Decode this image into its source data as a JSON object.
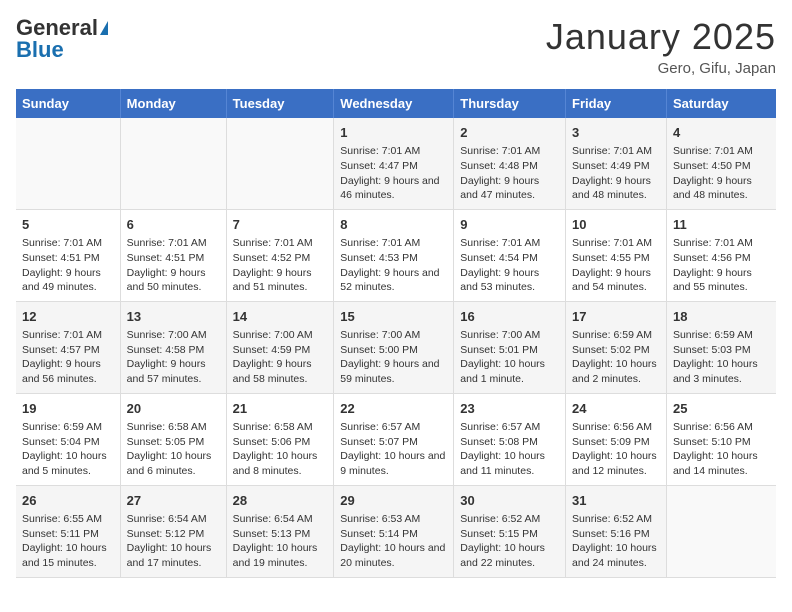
{
  "header": {
    "logo_general": "General",
    "logo_blue": "Blue",
    "month": "January 2025",
    "location": "Gero, Gifu, Japan"
  },
  "weekdays": [
    "Sunday",
    "Monday",
    "Tuesday",
    "Wednesday",
    "Thursday",
    "Friday",
    "Saturday"
  ],
  "weeks": [
    [
      {
        "day": "",
        "info": ""
      },
      {
        "day": "",
        "info": ""
      },
      {
        "day": "",
        "info": ""
      },
      {
        "day": "1",
        "info": "Sunrise: 7:01 AM\nSunset: 4:47 PM\nDaylight: 9 hours and 46 minutes."
      },
      {
        "day": "2",
        "info": "Sunrise: 7:01 AM\nSunset: 4:48 PM\nDaylight: 9 hours and 47 minutes."
      },
      {
        "day": "3",
        "info": "Sunrise: 7:01 AM\nSunset: 4:49 PM\nDaylight: 9 hours and 48 minutes."
      },
      {
        "day": "4",
        "info": "Sunrise: 7:01 AM\nSunset: 4:50 PM\nDaylight: 9 hours and 48 minutes."
      }
    ],
    [
      {
        "day": "5",
        "info": "Sunrise: 7:01 AM\nSunset: 4:51 PM\nDaylight: 9 hours and 49 minutes."
      },
      {
        "day": "6",
        "info": "Sunrise: 7:01 AM\nSunset: 4:51 PM\nDaylight: 9 hours and 50 minutes."
      },
      {
        "day": "7",
        "info": "Sunrise: 7:01 AM\nSunset: 4:52 PM\nDaylight: 9 hours and 51 minutes."
      },
      {
        "day": "8",
        "info": "Sunrise: 7:01 AM\nSunset: 4:53 PM\nDaylight: 9 hours and 52 minutes."
      },
      {
        "day": "9",
        "info": "Sunrise: 7:01 AM\nSunset: 4:54 PM\nDaylight: 9 hours and 53 minutes."
      },
      {
        "day": "10",
        "info": "Sunrise: 7:01 AM\nSunset: 4:55 PM\nDaylight: 9 hours and 54 minutes."
      },
      {
        "day": "11",
        "info": "Sunrise: 7:01 AM\nSunset: 4:56 PM\nDaylight: 9 hours and 55 minutes."
      }
    ],
    [
      {
        "day": "12",
        "info": "Sunrise: 7:01 AM\nSunset: 4:57 PM\nDaylight: 9 hours and 56 minutes."
      },
      {
        "day": "13",
        "info": "Sunrise: 7:00 AM\nSunset: 4:58 PM\nDaylight: 9 hours and 57 minutes."
      },
      {
        "day": "14",
        "info": "Sunrise: 7:00 AM\nSunset: 4:59 PM\nDaylight: 9 hours and 58 minutes."
      },
      {
        "day": "15",
        "info": "Sunrise: 7:00 AM\nSunset: 5:00 PM\nDaylight: 9 hours and 59 minutes."
      },
      {
        "day": "16",
        "info": "Sunrise: 7:00 AM\nSunset: 5:01 PM\nDaylight: 10 hours and 1 minute."
      },
      {
        "day": "17",
        "info": "Sunrise: 6:59 AM\nSunset: 5:02 PM\nDaylight: 10 hours and 2 minutes."
      },
      {
        "day": "18",
        "info": "Sunrise: 6:59 AM\nSunset: 5:03 PM\nDaylight: 10 hours and 3 minutes."
      }
    ],
    [
      {
        "day": "19",
        "info": "Sunrise: 6:59 AM\nSunset: 5:04 PM\nDaylight: 10 hours and 5 minutes."
      },
      {
        "day": "20",
        "info": "Sunrise: 6:58 AM\nSunset: 5:05 PM\nDaylight: 10 hours and 6 minutes."
      },
      {
        "day": "21",
        "info": "Sunrise: 6:58 AM\nSunset: 5:06 PM\nDaylight: 10 hours and 8 minutes."
      },
      {
        "day": "22",
        "info": "Sunrise: 6:57 AM\nSunset: 5:07 PM\nDaylight: 10 hours and 9 minutes."
      },
      {
        "day": "23",
        "info": "Sunrise: 6:57 AM\nSunset: 5:08 PM\nDaylight: 10 hours and 11 minutes."
      },
      {
        "day": "24",
        "info": "Sunrise: 6:56 AM\nSunset: 5:09 PM\nDaylight: 10 hours and 12 minutes."
      },
      {
        "day": "25",
        "info": "Sunrise: 6:56 AM\nSunset: 5:10 PM\nDaylight: 10 hours and 14 minutes."
      }
    ],
    [
      {
        "day": "26",
        "info": "Sunrise: 6:55 AM\nSunset: 5:11 PM\nDaylight: 10 hours and 15 minutes."
      },
      {
        "day": "27",
        "info": "Sunrise: 6:54 AM\nSunset: 5:12 PM\nDaylight: 10 hours and 17 minutes."
      },
      {
        "day": "28",
        "info": "Sunrise: 6:54 AM\nSunset: 5:13 PM\nDaylight: 10 hours and 19 minutes."
      },
      {
        "day": "29",
        "info": "Sunrise: 6:53 AM\nSunset: 5:14 PM\nDaylight: 10 hours and 20 minutes."
      },
      {
        "day": "30",
        "info": "Sunrise: 6:52 AM\nSunset: 5:15 PM\nDaylight: 10 hours and 22 minutes."
      },
      {
        "day": "31",
        "info": "Sunrise: 6:52 AM\nSunset: 5:16 PM\nDaylight: 10 hours and 24 minutes."
      },
      {
        "day": "",
        "info": ""
      }
    ]
  ]
}
